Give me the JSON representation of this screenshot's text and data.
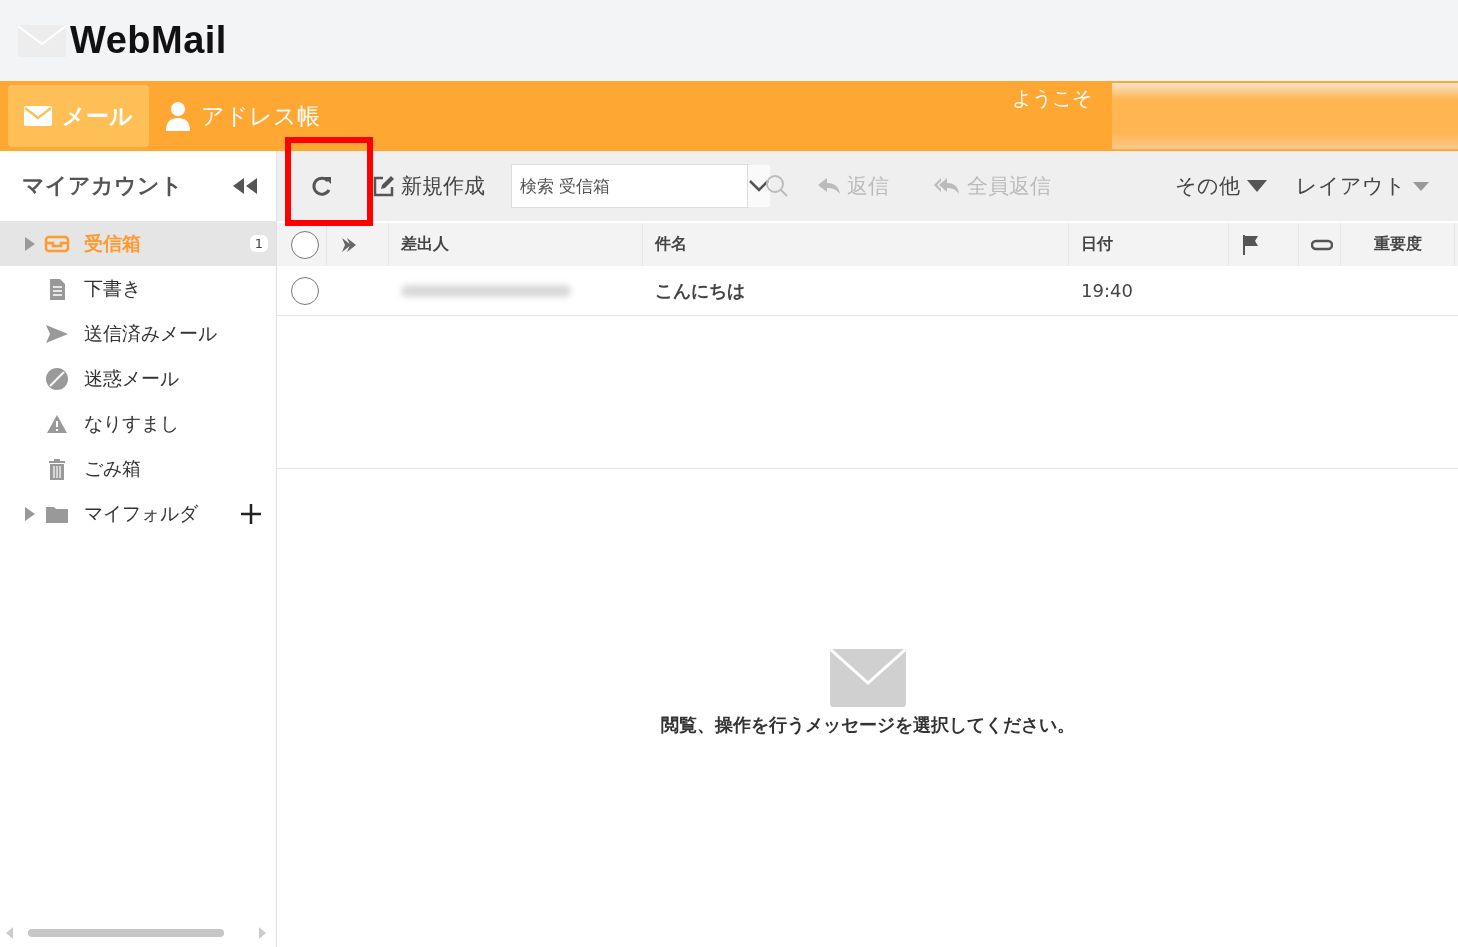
{
  "app": {
    "logo": "WebMail"
  },
  "nav": {
    "tabs": [
      {
        "label": "メール",
        "kind": "mail",
        "selected": true
      },
      {
        "label": "アドレス帳",
        "kind": "person",
        "selected": false
      }
    ],
    "welcome": "ようこそ"
  },
  "sidebar": {
    "title": "マイアカウント",
    "folders": [
      {
        "label": "受信箱",
        "kind": "inbox",
        "selected": true,
        "expandable": true,
        "count": "1"
      },
      {
        "label": "下書き",
        "kind": "draft",
        "selected": false,
        "expandable": false
      },
      {
        "label": "送信済みメール",
        "kind": "sent",
        "selected": false,
        "expandable": false
      },
      {
        "label": "迷惑メール",
        "kind": "spam",
        "selected": false,
        "expandable": false
      },
      {
        "label": "なりすまし",
        "kind": "warning",
        "selected": false,
        "expandable": false
      },
      {
        "label": "ごみ箱",
        "kind": "trash",
        "selected": false,
        "expandable": false
      },
      {
        "label": "マイフォルダ",
        "kind": "folder",
        "selected": false,
        "expandable": true,
        "addable": true
      }
    ]
  },
  "toolbar": {
    "refresh": {
      "highlighted": true
    },
    "compose": "新規作成",
    "search_placeholder": "検索 受信箱",
    "reply": {
      "label": "返信",
      "disabled": true
    },
    "reply_all": {
      "label": "全員返信",
      "disabled": true
    },
    "more": "その他",
    "layout": "レイアウト"
  },
  "table": {
    "select_all": {
      "checked": false
    },
    "columns": [
      {
        "kind": "check"
      },
      {
        "kind": "thread"
      },
      {
        "kind": "text",
        "label": "差出人"
      },
      {
        "kind": "text",
        "label": "件名"
      },
      {
        "kind": "text",
        "label": "日付"
      },
      {
        "kind": "flag"
      },
      {
        "kind": "attach"
      },
      {
        "kind": "text",
        "label": "重要度"
      }
    ],
    "rows": [
      {
        "selected": false,
        "subject": "こんにちは",
        "date": "19:40"
      }
    ]
  },
  "preview": {
    "message": "閲覧、操作を行うメッセージを選択してください。"
  }
}
